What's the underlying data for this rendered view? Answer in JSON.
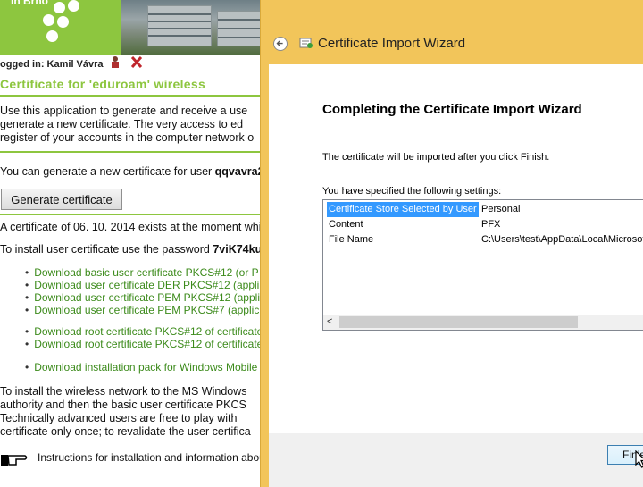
{
  "page": {
    "brand": "in Brno",
    "logged_in": "ogged in: Kamil Vávra",
    "title": "Certificate for 'eduroam' wireless",
    "intro": [
      "Use this application to generate and receive a use",
      "generate a new certificate. The very access to ed",
      "register of your accounts in the computer network o"
    ],
    "generate_text_prefix": "You can generate a new certificate for user ",
    "generate_user": "qqvavra2",
    "generate_text_suffix": " w",
    "generate_button": "Generate certificate",
    "existing": "A certificate of 06. 10. 2014 exists at the moment which",
    "password_prefix": "To install user certificate use the password ",
    "password": "7viK74ku",
    "links_group1": [
      "Download basic user certificate PKCS#12 (or P",
      "Download user certificate DER PKCS#12 (appli",
      "Download user certificate PEM PKCS#12 (appli",
      "Download user certificate PEM PKCS#7 (applic"
    ],
    "links_group2": [
      "Download root certificate PKCS#12 of certificate",
      "Download root certificate PKCS#12 of certificate"
    ],
    "links_group3": [
      "Download installation pack for Windows Mobile"
    ],
    "install_text": [
      "To install the wireless network to the MS Windows",
      "authority and then the basic user certificate PKCS",
      "Technically advanced users are free to play with",
      "certificate only once; to revalidate the user certifica"
    ],
    "instructions": "Instructions for installation and information abou"
  },
  "wizard": {
    "title": "Certificate Import Wizard",
    "heading": "Completing the Certificate Import Wizard",
    "info": "The certificate will be imported after you click Finish.",
    "specified": "You have specified the following settings:",
    "settings": [
      {
        "key": "Certificate Store Selected by User",
        "value": "Personal",
        "selected": true
      },
      {
        "key": "Content",
        "value": "PFX",
        "selected": false
      },
      {
        "key": "File Name",
        "value": "C:\\Users\\test\\AppData\\Local\\Microsoft",
        "selected": false
      }
    ],
    "scroll_left": "<",
    "finish_button": "Finish"
  },
  "colors": {
    "accent": "#8dc63f",
    "dialog_border": "#f2c55a",
    "selection": "#3399ff"
  },
  "icons": [
    "user-icon",
    "logout-icon",
    "back-arrow-icon",
    "certificate-icon",
    "pointing-hand-icon",
    "mouse-cursor-icon"
  ]
}
